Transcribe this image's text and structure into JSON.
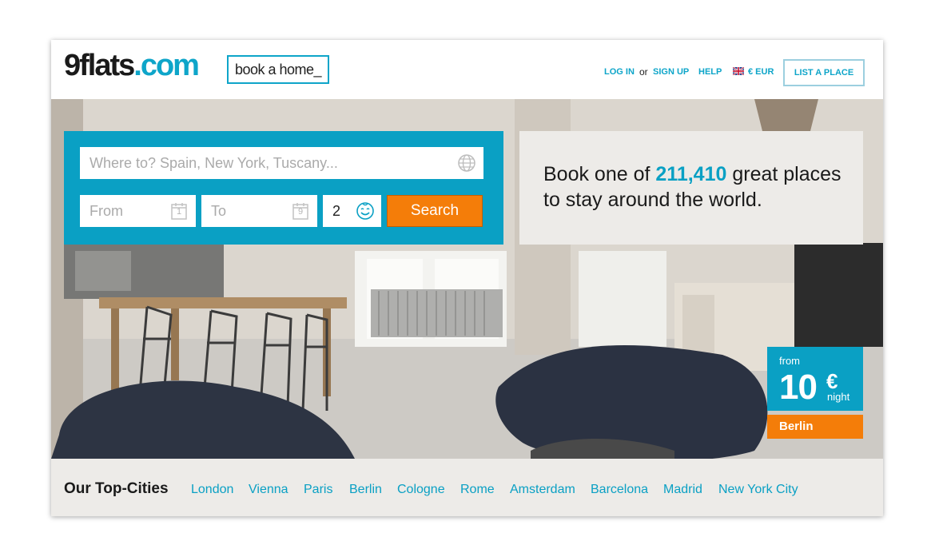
{
  "header": {
    "logo_main": "9flats",
    "logo_tld": ".com",
    "tagline": "book a home_",
    "login": "LOG IN",
    "or": "or",
    "signup": "SIGN UP",
    "help": "HELP",
    "currency": "€ EUR",
    "list_place": "LIST A PLACE"
  },
  "search": {
    "where_placeholder": "Where to? Spain, New York, Tuscany...",
    "from_placeholder": "From",
    "to_placeholder": "To",
    "from_icon_day": "1",
    "to_icon_day": "9",
    "guests": "2",
    "button": "Search"
  },
  "promo": {
    "prefix": "Book one of ",
    "count": "211,410",
    "suffix": " great places to stay around the world."
  },
  "price_badge": {
    "from": "from",
    "amount": "10",
    "currency": "€",
    "unit": "night",
    "city": "Berlin"
  },
  "top_cities": {
    "title": "Our Top-Cities",
    "cities": [
      "London",
      "Vienna",
      "Paris",
      "Berlin",
      "Cologne",
      "Rome",
      "Amsterdam",
      "Barcelona",
      "Madrid",
      "New York City"
    ]
  },
  "colors": {
    "accent": "#0aa0c4",
    "orange": "#f47d09",
    "panel": "#edebe8"
  }
}
